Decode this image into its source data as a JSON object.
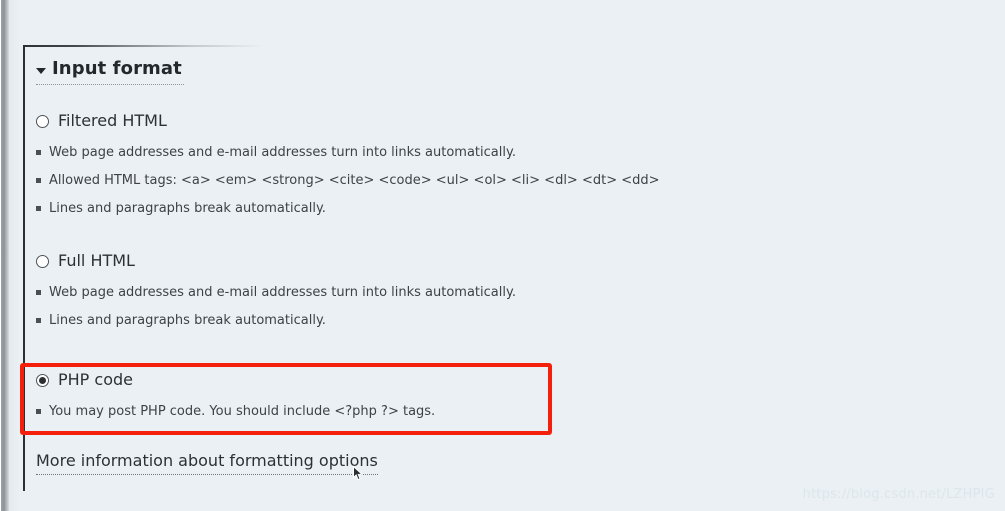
{
  "fieldset": {
    "legend": "Input format",
    "collapse_icon": "triangle-down-icon"
  },
  "options": [
    {
      "id": "filtered-html",
      "label": "Filtered HTML",
      "checked": false,
      "tips": [
        "Web page addresses and e-mail addresses turn into links automatically.",
        "Allowed HTML tags: <a> <em> <strong> <cite> <code> <ul> <ol> <li> <dl> <dt> <dd>",
        "Lines and paragraphs break automatically."
      ]
    },
    {
      "id": "full-html",
      "label": "Full HTML",
      "checked": false,
      "tips": [
        "Web page addresses and e-mail addresses turn into links automatically.",
        "Lines and paragraphs break automatically."
      ]
    },
    {
      "id": "php-code",
      "label": "PHP code",
      "checked": true,
      "tips": [
        "You may post PHP code. You should include <?php ?> tags."
      ]
    }
  ],
  "more_info": {
    "label": "More information about formatting options"
  },
  "highlight": {
    "color": "#f5200c",
    "target": "php-code"
  },
  "watermark": {
    "text": "https://blog.csdn.net/LZHPIG"
  }
}
